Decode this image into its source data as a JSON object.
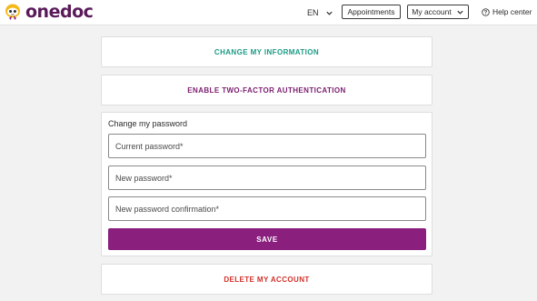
{
  "header": {
    "logo_text": "onedoc",
    "language": "EN",
    "appointments_label": "Appointments",
    "my_account_label": "My account",
    "help_label": "Help center"
  },
  "cards": {
    "change_info_label": "CHANGE MY INFORMATION",
    "two_factor_label": "ENABLE TWO-FACTOR AUTHENTICATION",
    "delete_account_label": "DELETE MY ACCOUNT"
  },
  "password_form": {
    "title": "Change my password",
    "current_password": {
      "placeholder": "Current password*",
      "value": ""
    },
    "new_password": {
      "placeholder": "New password*",
      "value": ""
    },
    "confirm_password": {
      "placeholder": "New password confirmation*",
      "value": ""
    },
    "save_label": "SAVE"
  },
  "colors": {
    "brand_purple": "#8a1f7e",
    "logo_text": "#5a1a5a",
    "link_green": "#1a9a84",
    "link_purple": "#7a1c6e",
    "danger_red": "#d0302a",
    "logo_yellow": "#f5b818"
  }
}
